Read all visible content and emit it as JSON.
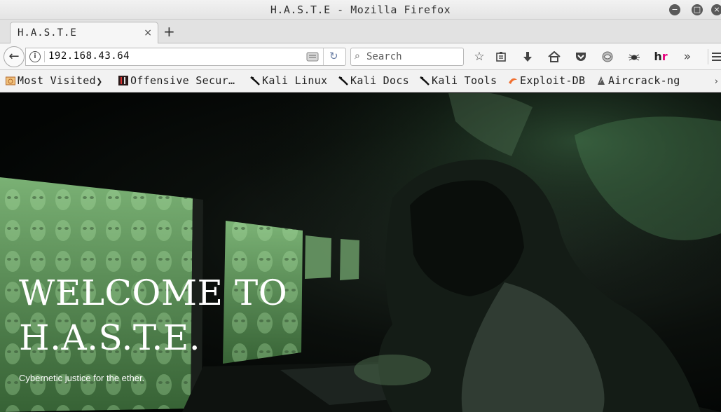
{
  "window": {
    "title": "H.A.S.T.E - Mozilla Firefox"
  },
  "tabs": [
    {
      "label": "H.A.S.T.E",
      "close": "×"
    }
  ],
  "new_tab_label": "+",
  "nav": {
    "url": "192.168.43.64",
    "search_placeholder": "Search"
  },
  "toolbar_icons": [
    "star-icon",
    "reading-list-icon",
    "download-icon",
    "home-icon",
    "pocket-icon",
    "extension-icon",
    "spider-icon",
    "hackerrank-icon",
    "overflow-icon",
    "menu-icon"
  ],
  "hackerrank_label": "hr",
  "bookmarks": [
    {
      "label": "Most Visited",
      "icon": "folder-icon"
    },
    {
      "label": "Offensive Secur…",
      "icon": "offsec-icon"
    },
    {
      "label": "Kali Linux",
      "icon": "kali-icon"
    },
    {
      "label": "Kali Docs",
      "icon": "kali-icon"
    },
    {
      "label": "Kali Tools",
      "icon": "kali-icon"
    },
    {
      "label": "Exploit-DB",
      "icon": "exploitdb-icon"
    },
    {
      "label": "Aircrack-ng",
      "icon": "aircrack-icon"
    }
  ],
  "hero": {
    "title_line1": "WELCOME TO",
    "title_line2": "H.A.S.T.E.",
    "subtitle": "Cybernetic justice for the ether."
  },
  "colors": {
    "hero_bg": "#050806",
    "monitor_green": "#7fbf7a",
    "hr_accent": "#e6007e"
  }
}
